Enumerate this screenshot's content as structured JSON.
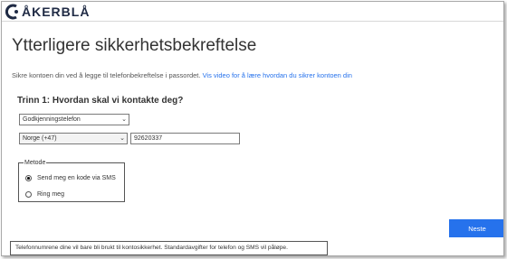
{
  "brand": {
    "logo_text": "ÅKERBLÅ",
    "accent": "#2672ec",
    "logo_color": "#1f2a44"
  },
  "page": {
    "title": "Ytterligere sikkerhetsbekreftelse",
    "intro_text": "Sikre kontoen din ved å legge til telefonbekreftelse i passordet.",
    "intro_link": "Vis video for å lære hvordan du sikrer kontoen din"
  },
  "step": {
    "heading": "Trinn 1: Hvordan skal vi kontakte deg?",
    "contact_method": {
      "value": "Godkjenningstelefon"
    },
    "country": {
      "value": "Norge (+47)"
    },
    "phone": {
      "value": "92620337"
    }
  },
  "method": {
    "legend": "Metode",
    "options": [
      {
        "label": "Send meg en kode via SMS",
        "checked": true
      },
      {
        "label": "Ring meg",
        "checked": false
      }
    ]
  },
  "actions": {
    "next_label": "Neste"
  },
  "footnote": "Telefonnumrene dine vil bare bli brukt til kontosikkerhet. Standardavgifter for telefon og SMS vil påløpe.",
  "icons": {
    "logo": "logo-mark-icon",
    "dropdown": "chevron-down-icon",
    "radio_checked": "radio-checked-icon",
    "radio_unchecked": "radio-unchecked-icon"
  }
}
